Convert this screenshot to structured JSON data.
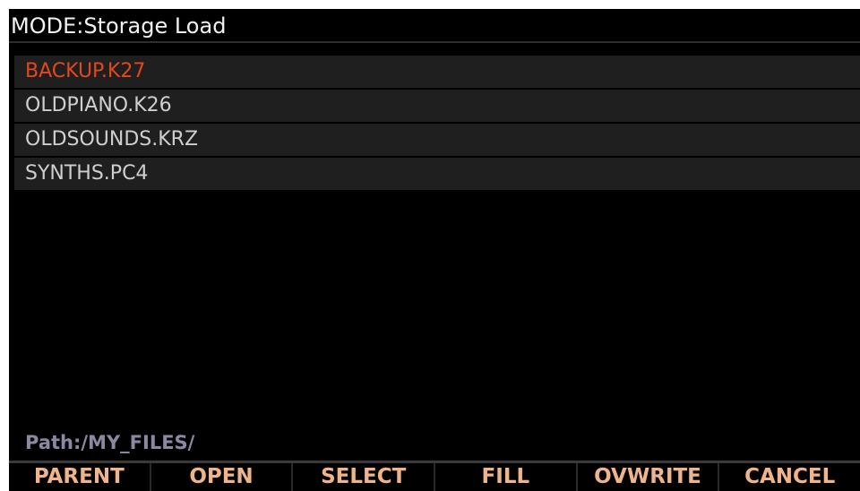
{
  "title": "MODE:Storage Load",
  "files": [
    {
      "name": "BACKUP.K27",
      "selected": true
    },
    {
      "name": "OLDPIANO.K26",
      "selected": false
    },
    {
      "name": "OLDSOUNDS.KRZ",
      "selected": false
    },
    {
      "name": "SYNTHS.PC4",
      "selected": false
    }
  ],
  "path": "Path:/MY_FILES/",
  "softkeys": [
    "PARENT",
    "OPEN",
    "SELECT",
    "FILL",
    "OVWRITE",
    "CANCEL"
  ],
  "colors": {
    "selected_text": "#e2481e",
    "normal_text": "#cfcfcf",
    "softkey_text": "#f0b48a",
    "path_text": "#8d88a2"
  }
}
